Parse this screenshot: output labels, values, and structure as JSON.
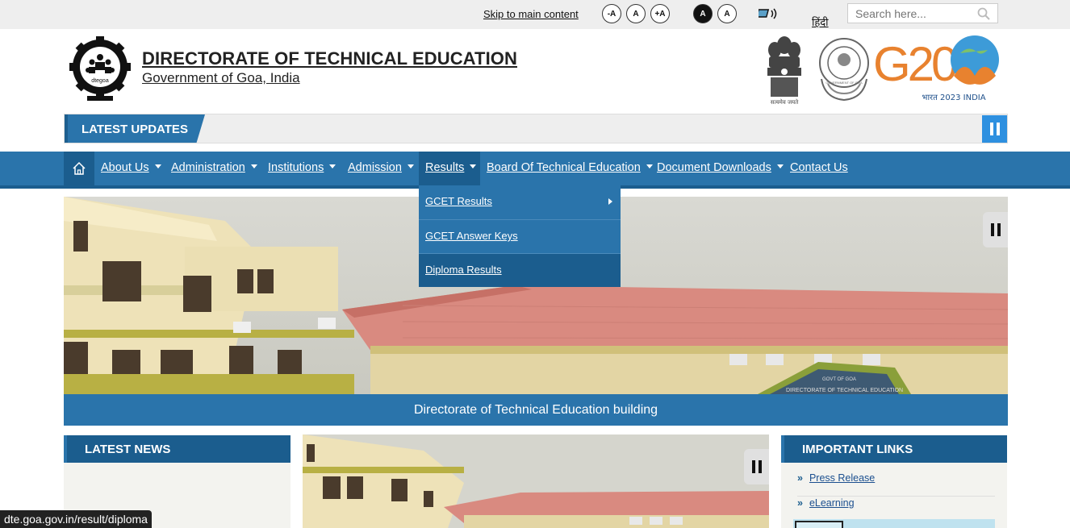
{
  "topbar": {
    "skip_link": "Skip to main content",
    "font_buttons": [
      "-A",
      "A",
      "+A"
    ],
    "contrast_buttons": [
      "A",
      "A"
    ],
    "language": "हिंदी",
    "search_placeholder": "Search here..."
  },
  "header": {
    "title": "DIRECTORATE OF TECHNICAL EDUCATION",
    "subtitle": "Government of Goa, India",
    "logo_caption": "dtegoa",
    "emblem_motto": "सत्यमेव जयते",
    "seal_text": "GOVERNMENT OF GOA",
    "g20_text": "G20",
    "g20_caption": "भारत 2023 INDIA"
  },
  "updates": {
    "label": "LATEST UPDATES"
  },
  "nav": {
    "items": [
      {
        "label": "About Us",
        "caret": true
      },
      {
        "label": "Administration",
        "caret": true
      },
      {
        "label": "Institutions",
        "caret": true
      },
      {
        "label": "Admission",
        "caret": true
      },
      {
        "label": "Results",
        "caret": true
      },
      {
        "label": "Board Of Technical Education",
        "caret": true
      },
      {
        "label": "Document Downloads",
        "caret": true
      },
      {
        "label": "Contact Us",
        "caret": false
      }
    ],
    "dropdown": [
      {
        "label": "GCET Results"
      },
      {
        "label": "GCET Answer Keys"
      },
      {
        "label": "Diploma Results"
      }
    ]
  },
  "slider": {
    "caption": "Directorate of Technical Education building",
    "sign_text": "GOVT OF GOA",
    "sign_text_2": "DIRECTORATE OF TECHNICAL EDUCATION"
  },
  "news": {
    "title": "LATEST NEWS"
  },
  "links": {
    "title": "IMPORTANT LINKS",
    "items": [
      {
        "bullet": "»",
        "label": "Press Release"
      },
      {
        "bullet": "»",
        "label": "eLearning"
      }
    ]
  },
  "status_url": "dte.goa.gov.in/result/diploma",
  "colors": {
    "primary": "#2a74ab",
    "primary_dark": "#1b5d8e",
    "topbar": "#eeeeee"
  }
}
